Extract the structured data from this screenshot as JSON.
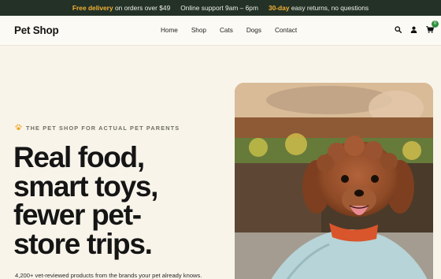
{
  "announcement": {
    "part1_highlight": "Free delivery",
    "part1_rest": "on orders over $49",
    "part2": "Online support 9am – 6pm",
    "part3_highlight": "30-day",
    "part3_rest": "easy returns, no questions"
  },
  "header": {
    "logo": "Pet Shop",
    "nav": [
      "Home",
      "Shop",
      "Cats",
      "Dogs",
      "Contact"
    ],
    "icons": [
      "search-icon",
      "user-icon",
      "cart-icon"
    ],
    "cart_count": "0"
  },
  "hero": {
    "eyebrow": "THE PET SHOP FOR ACTUAL PET PARENTS",
    "headline_lines": [
      "Real food,",
      "smart toys,",
      "fewer pet-",
      "store trips."
    ],
    "subtext": "4,200+ vet-reviewed products from the brands your pet already knows."
  },
  "colors": {
    "topbar_bg": "#233126",
    "highlight": "#f2b134",
    "page_bg": "#f8f4ea",
    "badge": "#2f8f3c"
  }
}
